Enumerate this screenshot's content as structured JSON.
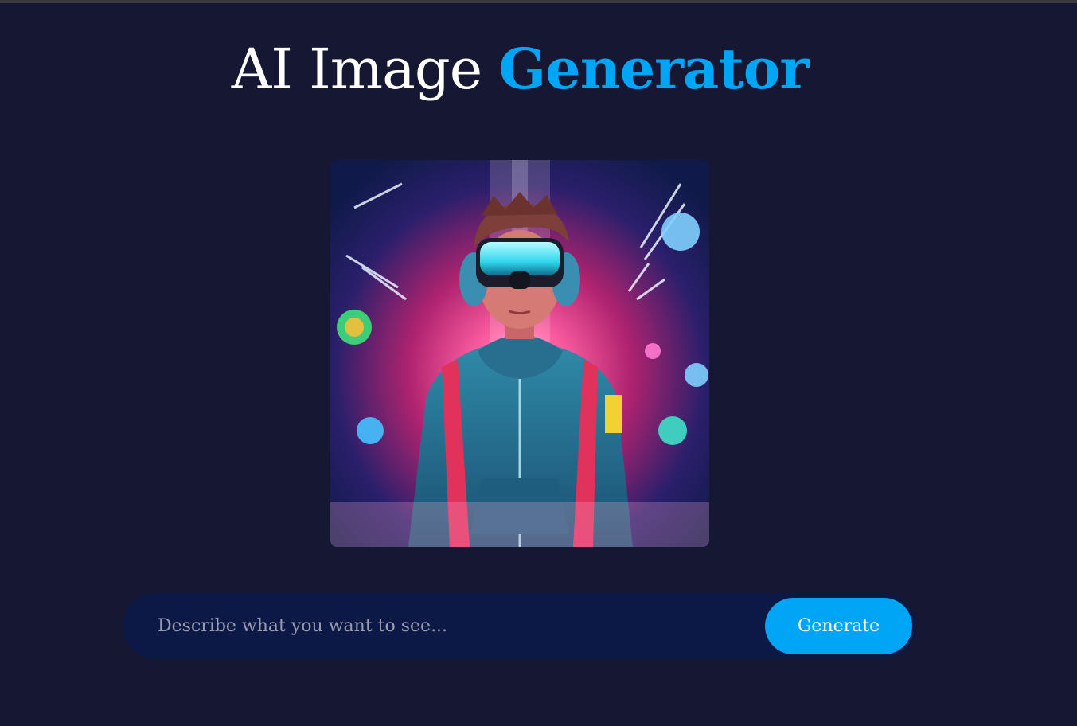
{
  "header": {
    "title_plain": "AI Image ",
    "title_accent": "Generator"
  },
  "image": {
    "subject_icon": "vr-headset-boy-illustration"
  },
  "prompt": {
    "placeholder": "Describe what you want to see...",
    "value": "",
    "button_label": "Generate"
  },
  "colors": {
    "background": "#151733",
    "accent": "#00a6f5",
    "input_bar": "#0c1947"
  }
}
